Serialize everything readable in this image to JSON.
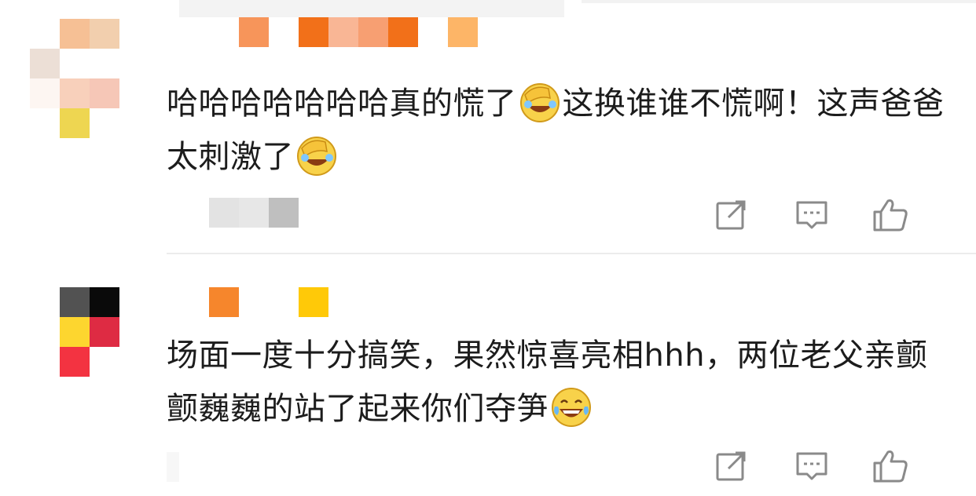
{
  "comments": [
    {
      "text_part1": "哈哈哈哈哈哈哈真的慌了",
      "text_part2": "这换谁谁不慌啊！这声爸爸太刺激了",
      "emoji1": "facepalm-laugh-emoji",
      "emoji2": "facepalm-laugh-emoji"
    },
    {
      "text_part1": "场面一度十分搞笑，果然惊喜亮相hhh，两位老父亲颤颤巍巍的站了起来你们夺笋",
      "emoji1": "tears-of-joy-emoji"
    }
  ],
  "icons": {
    "share": "share-icon",
    "reply": "comment-icon",
    "like": "thumbs-up-icon"
  },
  "colors": {
    "text": "#1c1c1c",
    "icon": "#8a8a8a",
    "divider": "#ececec"
  }
}
